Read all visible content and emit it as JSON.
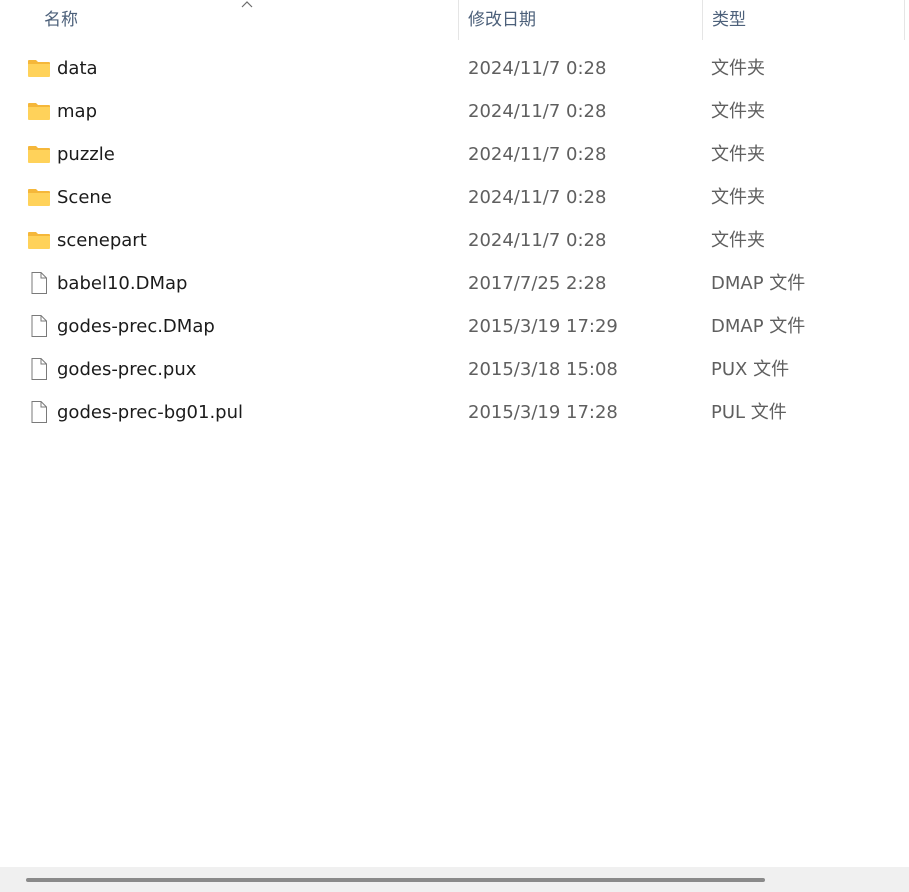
{
  "columns": {
    "name": "名称",
    "date": "修改日期",
    "type": "类型"
  },
  "sort": {
    "column": "name",
    "direction": "ascending",
    "icon": "chevron-up-icon"
  },
  "files": [
    {
      "name": "data",
      "date": "2024/11/7 0:28",
      "type": "文件夹",
      "icon": "folder-icon"
    },
    {
      "name": "map",
      "date": "2024/11/7 0:28",
      "type": "文件夹",
      "icon": "folder-icon"
    },
    {
      "name": "puzzle",
      "date": "2024/11/7 0:28",
      "type": "文件夹",
      "icon": "folder-icon"
    },
    {
      "name": "Scene",
      "date": "2024/11/7 0:28",
      "type": "文件夹",
      "icon": "folder-icon"
    },
    {
      "name": "scenepart",
      "date": "2024/11/7 0:28",
      "type": "文件夹",
      "icon": "folder-icon"
    },
    {
      "name": "babel10.DMap",
      "date": "2017/7/25 2:28",
      "type": "DMAP 文件",
      "icon": "file-icon"
    },
    {
      "name": "godes-prec.DMap",
      "date": "2015/3/19 17:29",
      "type": "DMAP 文件",
      "icon": "file-icon"
    },
    {
      "name": "godes-prec.pux",
      "date": "2015/3/18 15:08",
      "type": "PUX 文件",
      "icon": "file-icon"
    },
    {
      "name": "godes-prec-bg01.pul",
      "date": "2015/3/19 17:28",
      "type": "PUL 文件",
      "icon": "file-icon"
    }
  ],
  "colors": {
    "header_text": "#4c607a",
    "name_text": "#1b1b1b",
    "meta_text": "#5f5f5f",
    "folder_fill": "#ffd25a",
    "folder_tab": "#f5b73a",
    "scrollbar_track": "#f0f0f0",
    "scrollbar_thumb": "#8a8a8a"
  }
}
